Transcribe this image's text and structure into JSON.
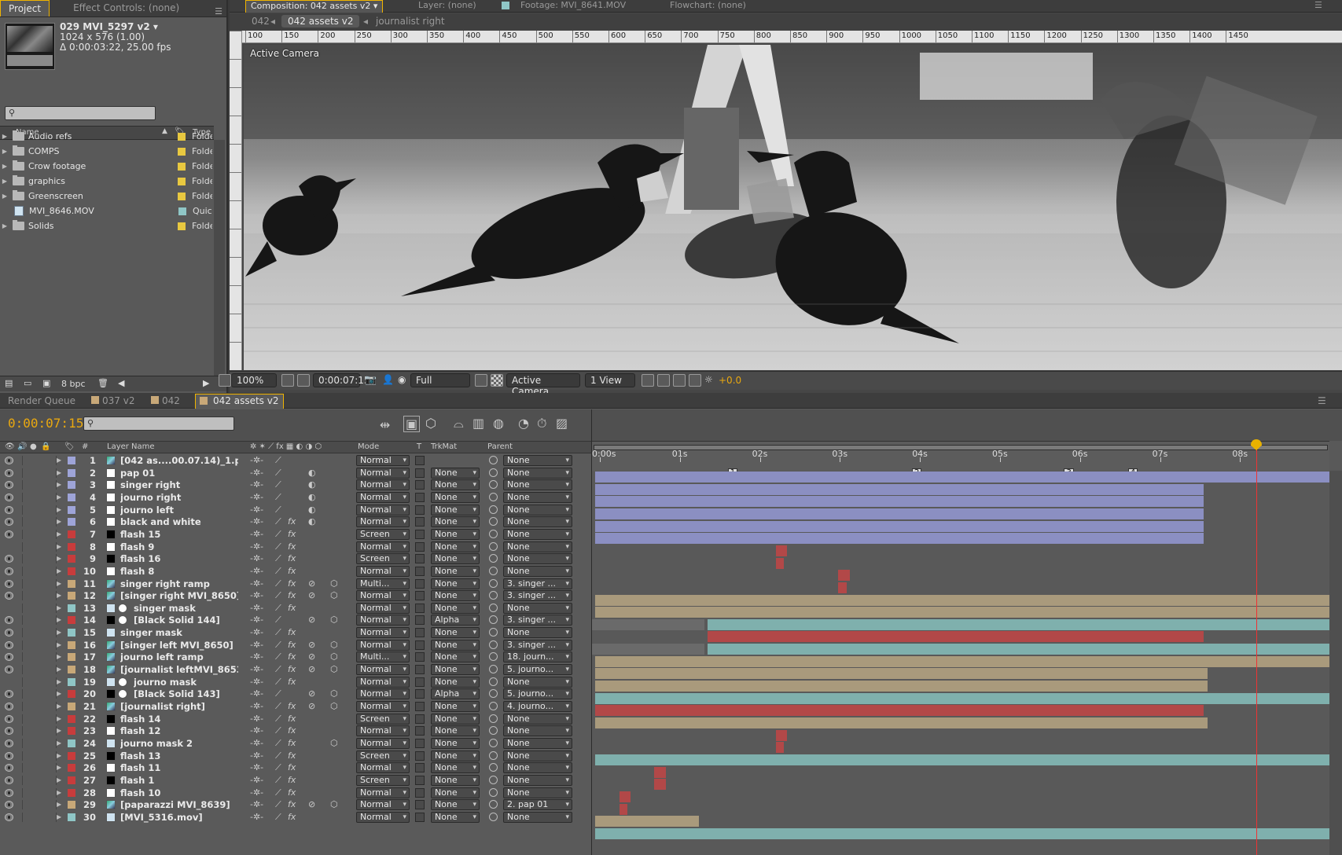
{
  "project": {
    "tabs": [
      "Project",
      "Effect Controls: (none)"
    ],
    "item_name": "029 MVI_5297 v2 ▾",
    "item_dims": "1024 x 576 (1.00)",
    "item_duration": "Δ 0:00:03:22, 25.00 fps",
    "columns": {
      "name": "Name",
      "type": "Type"
    },
    "items": [
      {
        "name": "Audio refs",
        "type": "Folde",
        "color": "#e8c840",
        "kind": "folder"
      },
      {
        "name": "COMPS",
        "type": "Folde",
        "color": "#e8c840",
        "kind": "folder"
      },
      {
        "name": "Crow footage",
        "type": "Folde",
        "color": "#e8c840",
        "kind": "folder"
      },
      {
        "name": "graphics",
        "type": "Folde",
        "color": "#e8c840",
        "kind": "folder"
      },
      {
        "name": "Greenscreen",
        "type": "Folde",
        "color": "#e8c840",
        "kind": "folder"
      },
      {
        "name": "MVI_8646.MOV",
        "type": "Quic",
        "color": "#8fc6c6",
        "kind": "file"
      },
      {
        "name": "Solids",
        "type": "Folde",
        "color": "#e8c840",
        "kind": "folder"
      }
    ],
    "bpc": "8 bpc"
  },
  "comp": {
    "tabs": [
      "Composition: 042 assets v2 ▾",
      "Layer: (none)",
      "Footage: MVI_8641.MOV",
      "Flowchart: (none)"
    ],
    "crumbs": [
      "042",
      "042 assets v2",
      "journalist right"
    ],
    "ruler_labels": [
      "100",
      "150",
      "200",
      "250",
      "300",
      "350",
      "400",
      "450",
      "500",
      "550",
      "600",
      "650",
      "700",
      "750",
      "800",
      "850",
      "900",
      "950",
      "1000",
      "1050",
      "1100",
      "1150",
      "1200",
      "1250",
      "1300",
      "1350",
      "1400",
      "1450"
    ],
    "viewer_label": "Active Camera",
    "toolbar": {
      "zoom": "100%",
      "time": "0:00:07:15",
      "resolution": "Full",
      "camera": "Active Camera",
      "views": "1 View",
      "exposure": "+0.0"
    }
  },
  "timeline": {
    "tabs": [
      "Render Queue",
      "037 v2",
      "042",
      "042 assets v2"
    ],
    "timecode": "0:00:07:15",
    "columns": {
      "layer_name": "Layer Name",
      "num": "#",
      "mode": "Mode",
      "t": "T",
      "trkmat": "TrkMat",
      "parent": "Parent"
    },
    "time_labels": [
      "0:00s",
      "01s",
      "02s",
      "03s",
      "04s",
      "05s",
      "06s",
      "07s",
      "08s"
    ],
    "markers": [
      "1",
      "2",
      "3",
      "4"
    ],
    "layers": [
      {
        "n": "1",
        "name": "[042 as....00.07.14)_1.psd]",
        "label": "#9ea4d8",
        "icon": "img",
        "mode": "Normal",
        "trk": "",
        "parent": "None",
        "bar": "purple",
        "start": 0,
        "end": 10.0
      },
      {
        "n": "2",
        "name": "pap 01",
        "label": "#9ea4d8",
        "icon": "white",
        "mode": "Normal",
        "trk": "None",
        "parent": "None",
        "bar": "purple",
        "start": 0,
        "end": 7.6
      },
      {
        "n": "3",
        "name": "singer right",
        "label": "#9ea4d8",
        "icon": "white",
        "mode": "Normal",
        "trk": "None",
        "parent": "None",
        "bar": "purple",
        "start": 0,
        "end": 7.6
      },
      {
        "n": "4",
        "name": "journo right",
        "label": "#9ea4d8",
        "icon": "white",
        "mode": "Normal",
        "trk": "None",
        "parent": "None",
        "bar": "purple",
        "start": 0,
        "end": 7.6
      },
      {
        "n": "5",
        "name": "journo left",
        "label": "#9ea4d8",
        "icon": "white",
        "mode": "Normal",
        "trk": "None",
        "parent": "None",
        "bar": "purple",
        "start": 0,
        "end": 7.6
      },
      {
        "n": "6",
        "name": "black and white",
        "label": "#9ea4d8",
        "icon": "white",
        "mode": "Normal",
        "trk": "None",
        "parent": "None",
        "bar": "purple",
        "start": 0,
        "end": 7.6
      },
      {
        "n": "7",
        "name": "flash 15",
        "label": "#c83c3c",
        "icon": "black",
        "mode": "Screen",
        "trk": "None",
        "parent": "None",
        "bar": "red",
        "start": 2.26,
        "end": 2.4
      },
      {
        "n": "8",
        "name": "flash 9",
        "label": "#c83c3c",
        "icon": "white",
        "mode": "Normal",
        "trk": "None",
        "parent": "None",
        "bar": "red",
        "start": 2.26,
        "end": 2.36
      },
      {
        "n": "9",
        "name": "flash 16",
        "label": "#c83c3c",
        "icon": "black",
        "mode": "Screen",
        "trk": "None",
        "parent": "None",
        "bar": "red",
        "start": 3.04,
        "end": 3.18
      },
      {
        "n": "10",
        "name": "flash 8",
        "label": "#c83c3c",
        "icon": "white",
        "mode": "Normal",
        "trk": "None",
        "parent": "None",
        "bar": "red",
        "start": 3.04,
        "end": 3.14
      },
      {
        "n": "11",
        "name": "singer right ramp",
        "label": "#c8a878",
        "icon": "img",
        "mode": "Multi...",
        "trk": "None",
        "parent": "3. singer ...",
        "bar": "tan",
        "start": 0,
        "end": 10.0
      },
      {
        "n": "12",
        "name": "[singer right MVI_8650]",
        "label": "#c8a878",
        "icon": "img",
        "mode": "Normal",
        "trk": "None",
        "parent": "3. singer ...",
        "bar": "tan",
        "start": 0,
        "end": 10.0
      },
      {
        "n": "13",
        "name": "singer mask",
        "label": "#8fc6c6",
        "icon": "mov",
        "icon2": true,
        "mode": "Normal",
        "trk": "None",
        "parent": "None",
        "bar": "teal",
        "start": 1.4,
        "end": 10.0
      },
      {
        "n": "14",
        "name": "[Black Solid 144]",
        "label": "#c83c3c",
        "icon": "black",
        "icon2": true,
        "mode": "Normal",
        "trk": "Alpha",
        "parent": "3. singer ...",
        "bar": "red",
        "start": 1.4,
        "end": 7.6
      },
      {
        "n": "15",
        "name": "singer mask",
        "label": "#8fc6c6",
        "icon": "mov",
        "mode": "Normal",
        "trk": "None",
        "parent": "None",
        "bar": "teal",
        "start": 1.4,
        "end": 10.0
      },
      {
        "n": "16",
        "name": "[singer left MVI_8650]",
        "label": "#c8a878",
        "icon": "img",
        "mode": "Normal",
        "trk": "None",
        "parent": "3. singer ...",
        "bar": "tan",
        "start": 0,
        "end": 10.0
      },
      {
        "n": "17",
        "name": "journo left ramp",
        "label": "#c8a878",
        "icon": "img",
        "mode": "Multi...",
        "trk": "None",
        "parent": "18. journ...",
        "bar": "tan",
        "start": 0,
        "end": 7.65
      },
      {
        "n": "18",
        "name": "[journalist leftMVI_8653]",
        "label": "#c8a878",
        "icon": "img",
        "mode": "Normal",
        "trk": "None",
        "parent": "5. journo...",
        "bar": "tan",
        "start": 0,
        "end": 7.65
      },
      {
        "n": "19",
        "name": "journo mask",
        "label": "#8fc6c6",
        "icon": "mov",
        "icon2": true,
        "mode": "Normal",
        "trk": "None",
        "parent": "None",
        "bar": "teal",
        "start": 0,
        "end": 10.0
      },
      {
        "n": "20",
        "name": "[Black Solid 143]",
        "label": "#c83c3c",
        "icon": "black",
        "icon2": true,
        "mode": "Normal",
        "trk": "Alpha",
        "parent": "5. journo...",
        "bar": "red",
        "start": 0,
        "end": 7.6
      },
      {
        "n": "21",
        "name": "[journalist right]",
        "label": "#c8a878",
        "icon": "img",
        "mode": "Normal",
        "trk": "None",
        "parent": "4. journo...",
        "bar": "tan",
        "start": 0,
        "end": 7.65
      },
      {
        "n": "22",
        "name": "flash 14",
        "label": "#c83c3c",
        "icon": "black",
        "mode": "Screen",
        "trk": "None",
        "parent": "None",
        "bar": "red",
        "start": 2.26,
        "end": 2.4
      },
      {
        "n": "23",
        "name": "flash 12",
        "label": "#c83c3c",
        "icon": "white",
        "mode": "Normal",
        "trk": "None",
        "parent": "None",
        "bar": "red",
        "start": 2.26,
        "end": 2.36
      },
      {
        "n": "24",
        "name": "journo mask 2",
        "label": "#8fc6c6",
        "icon": "mov",
        "mode": "Normal",
        "trk": "None",
        "parent": "None",
        "bar": "teal",
        "start": 0,
        "end": 10.0
      },
      {
        "n": "25",
        "name": "flash 13",
        "label": "#c83c3c",
        "icon": "black",
        "mode": "Screen",
        "trk": "None",
        "parent": "None",
        "bar": "red",
        "start": 0.74,
        "end": 0.88
      },
      {
        "n": "26",
        "name": "flash 11",
        "label": "#c83c3c",
        "icon": "white",
        "mode": "Normal",
        "trk": "None",
        "parent": "None",
        "bar": "red",
        "start": 0.74,
        "end": 0.88
      },
      {
        "n": "27",
        "name": "flash 1",
        "label": "#c83c3c",
        "icon": "black",
        "mode": "Screen",
        "trk": "None",
        "parent": "None",
        "bar": "red",
        "start": 0.3,
        "end": 0.44
      },
      {
        "n": "28",
        "name": "flash 10",
        "label": "#c83c3c",
        "icon": "white",
        "mode": "Normal",
        "trk": "None",
        "parent": "None",
        "bar": "red",
        "start": 0.3,
        "end": 0.4
      },
      {
        "n": "29",
        "name": "[paparazzi MVI_8639]",
        "label": "#c8a878",
        "icon": "img",
        "mode": "Normal",
        "trk": "None",
        "parent": "2. pap 01",
        "bar": "tan",
        "start": 0,
        "end": 1.3
      },
      {
        "n": "30",
        "name": "[MVI_5316.mov]",
        "label": "#8fc6c6",
        "icon": "mov",
        "mode": "Normal",
        "trk": "None",
        "parent": "None",
        "bar": "teal",
        "start": 0,
        "end": 10.0
      }
    ]
  }
}
